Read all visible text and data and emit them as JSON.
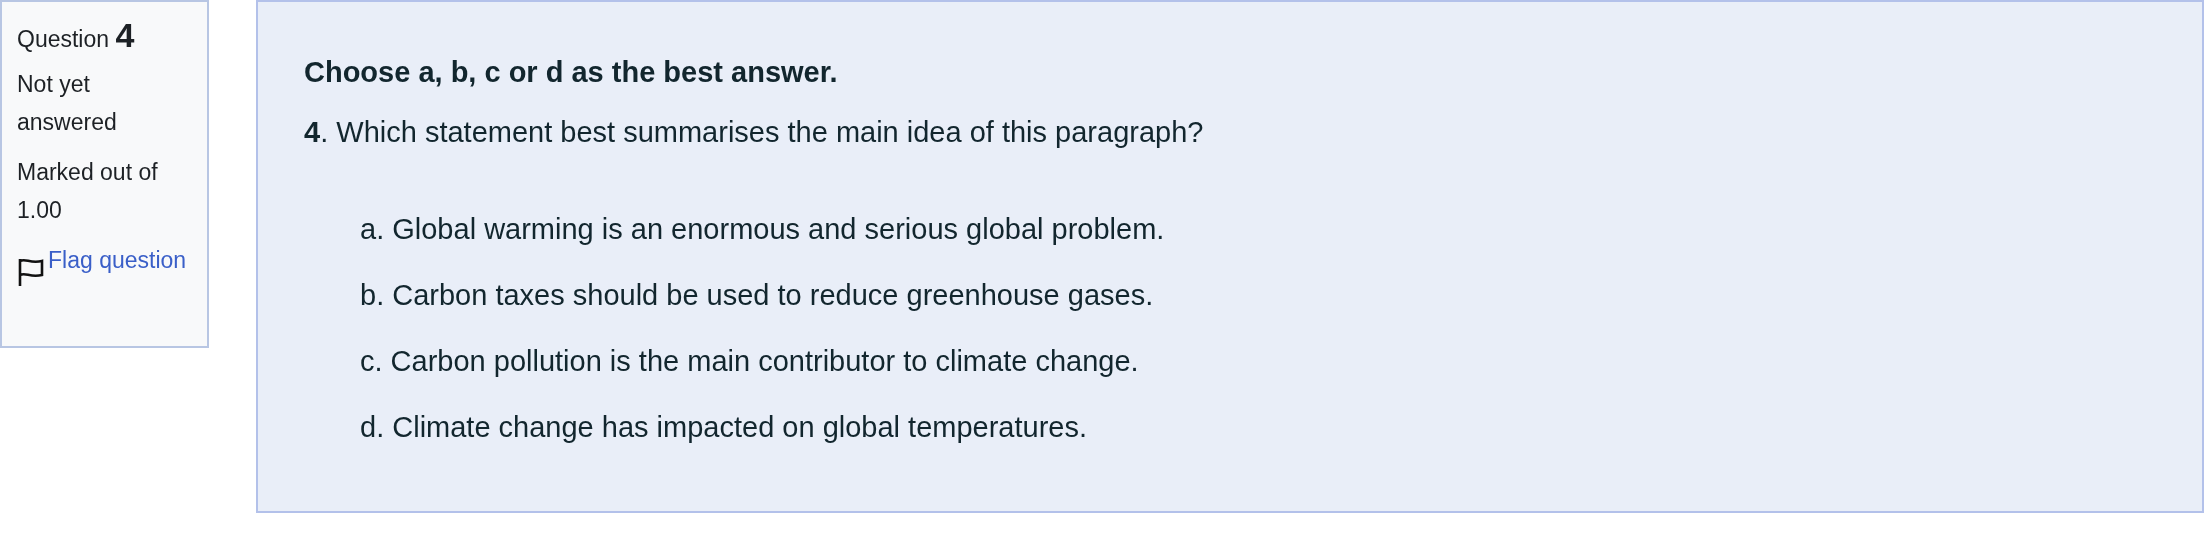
{
  "info": {
    "question_label": "Question",
    "question_number": "4",
    "state": "Not yet answered",
    "mark": "Marked out of 1.00",
    "flag_link": "Flag question"
  },
  "content": {
    "instruction": "Choose a, b, c or d as the best answer.",
    "question": "**4**. Which statement best summarises the main idea of this paragraph?",
    "options": [
      {
        "text": "a. Global warming is an enormous and serious global problem."
      },
      {
        "text": "b. Carbon taxes should be used to reduce greenhouse gases."
      },
      {
        "text": "c. Carbon pollution is the main contributor to climate change."
      },
      {
        "text": "d. Climate change has impacted on global temperatures."
      }
    ]
  }
}
